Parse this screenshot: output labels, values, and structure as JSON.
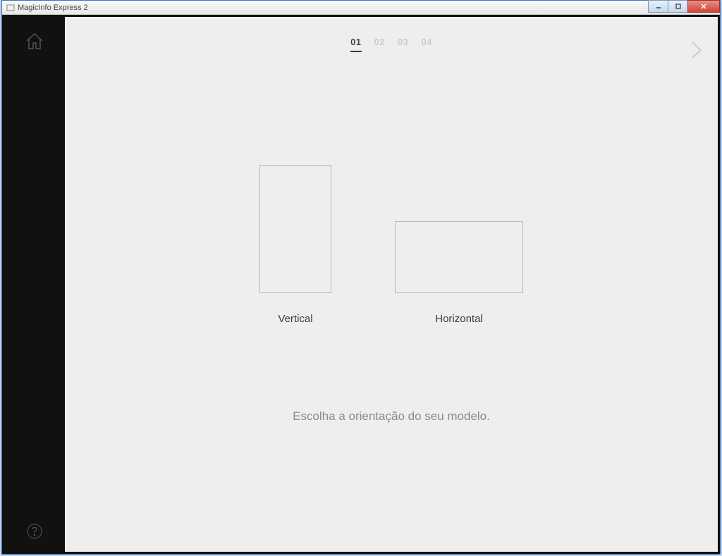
{
  "window": {
    "title": "MagicInfo Express 2"
  },
  "steps": {
    "items": [
      "01",
      "02",
      "03",
      "04"
    ],
    "active_index": 0,
    "s1": "01",
    "s2": "02",
    "s3": "03",
    "s4": "04"
  },
  "orientation": {
    "vertical_label": "Vertical",
    "horizontal_label": "Horizontal"
  },
  "instruction": "Escolha a orientação do seu modelo."
}
